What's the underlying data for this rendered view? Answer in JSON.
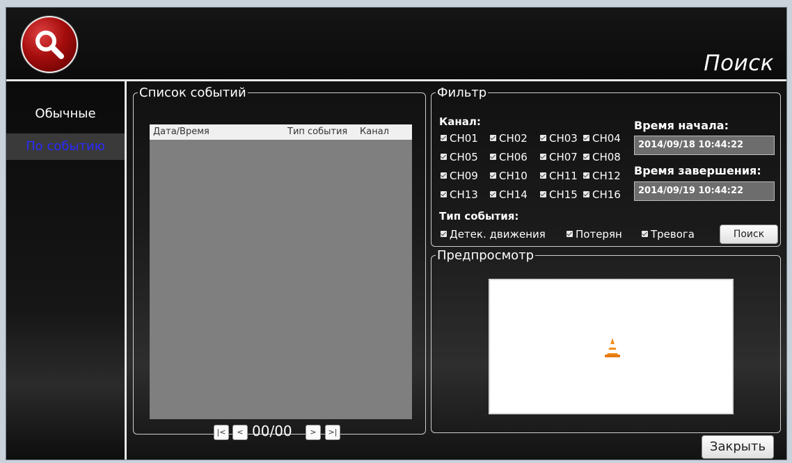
{
  "header": {
    "title": "Поиск"
  },
  "sidebar": {
    "items": [
      {
        "label": "Обычные"
      },
      {
        "label": "По событию"
      }
    ]
  },
  "event_list": {
    "title": "Список событий",
    "columns": [
      "Дата/Время",
      "Тип события",
      "Канал"
    ],
    "rows": [],
    "pager": {
      "first": "|<",
      "prev": "<",
      "info": "00/00",
      "next": ">",
      "last": ">|"
    }
  },
  "filter": {
    "title": "Фильтр",
    "channel_label": "Канал:",
    "channels": [
      {
        "name": "CH01",
        "checked": true
      },
      {
        "name": "CH02",
        "checked": true
      },
      {
        "name": "CH03",
        "checked": true
      },
      {
        "name": "CH04",
        "checked": true
      },
      {
        "name": "CH05",
        "checked": true
      },
      {
        "name": "CH06",
        "checked": true
      },
      {
        "name": "CH07",
        "checked": true
      },
      {
        "name": "CH08",
        "checked": true
      },
      {
        "name": "CH09",
        "checked": true
      },
      {
        "name": "CH10",
        "checked": true
      },
      {
        "name": "CH11",
        "checked": true
      },
      {
        "name": "CH12",
        "checked": true
      },
      {
        "name": "CH13",
        "checked": true
      },
      {
        "name": "CH14",
        "checked": true
      },
      {
        "name": "CH15",
        "checked": true
      },
      {
        "name": "CH16",
        "checked": true
      }
    ],
    "start_time_label": "Время начала:",
    "start_time": "2014/09/18 10:44:22",
    "end_time_label": "Время завершения:",
    "end_time": "2014/09/19 10:44:22",
    "event_type_label": "Тип события:",
    "event_types": [
      {
        "name": "Детек. движения",
        "checked": true
      },
      {
        "name": "Потерян",
        "checked": true
      },
      {
        "name": "Тревога",
        "checked": true
      }
    ],
    "search_button": "Поиск"
  },
  "preview": {
    "title": "Предпросмотр",
    "icon": "vlc-cone-icon"
  },
  "footer": {
    "close_button": "Закрыть"
  },
  "colors": {
    "accent_active": "#2a2aff",
    "background": "#0d0d0d",
    "logo": "#a50d0d"
  }
}
